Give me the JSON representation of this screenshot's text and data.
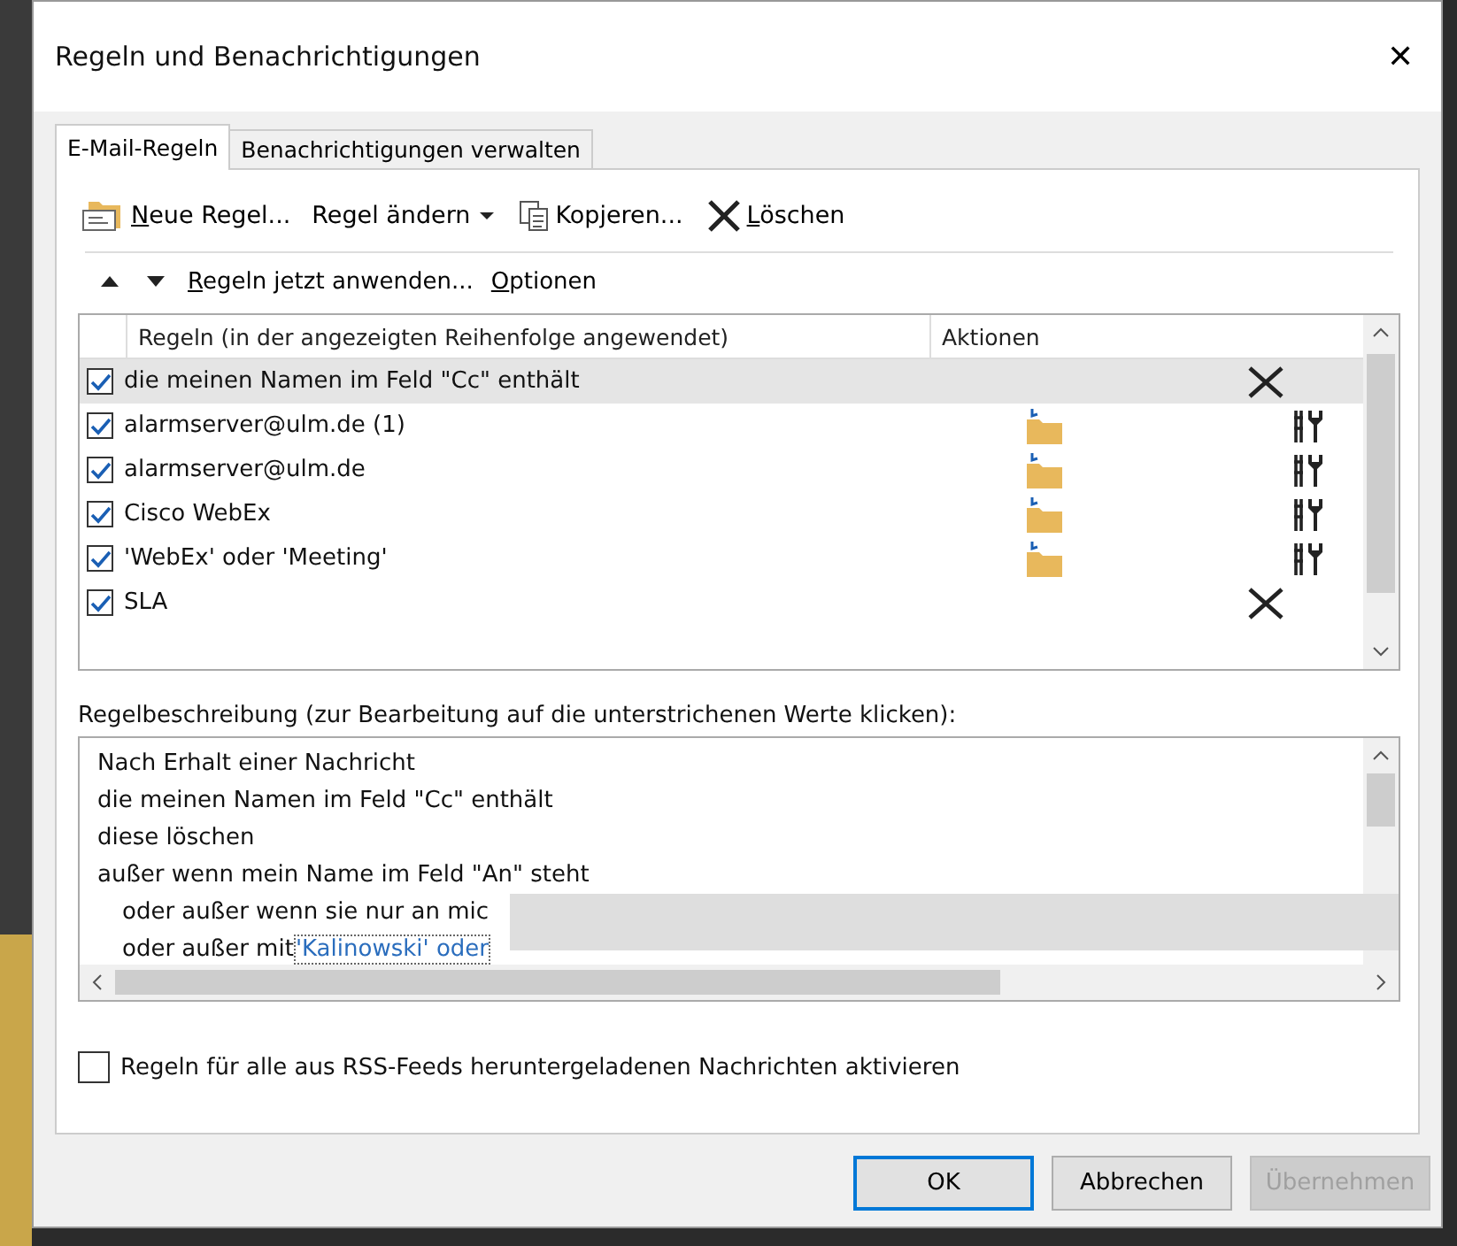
{
  "window": {
    "title": "Regeln und Benachrichtigungen",
    "close": "✕"
  },
  "tabs": [
    {
      "label": "E-Mail-Regeln",
      "selected": true
    },
    {
      "label": "Benachrichtigungen verwalten",
      "selected": false
    }
  ],
  "toolbar": [
    {
      "kind": "new",
      "accel": "N",
      "rest": "eue Regel..."
    },
    {
      "kind": "change",
      "rest": "Regel ändern"
    },
    {
      "kind": "copy",
      "rest": "Kopjeren..."
    },
    {
      "kind": "delete",
      "accel": "L",
      "rest": "öschen"
    }
  ],
  "toolbar2": {
    "apply": "Regeln jetzt anwenden...",
    "options": "Optionen"
  },
  "rules": {
    "columns": [
      "Regeln (in der angezeigten Reihenfolge angewendet)",
      "Aktionen"
    ],
    "rows": [
      {
        "name": "die meinen Namen im Feld \"Cc\" enthält",
        "checked": true,
        "selected": true,
        "kind": "delete"
      },
      {
        "name": "alarmserver@ulm.de (1)",
        "checked": true,
        "selected": false,
        "kind": "move"
      },
      {
        "name": "alarmserver@ulm.de",
        "checked": true,
        "selected": false,
        "kind": "move"
      },
      {
        "name": "Cisco WebEx",
        "checked": true,
        "selected": false,
        "kind": "move"
      },
      {
        "name": "'WebEx' oder 'Meeting'",
        "checked": true,
        "selected": false,
        "kind": "move"
      },
      {
        "name": "SLA",
        "checked": true,
        "selected": false,
        "kind": "delete"
      }
    ]
  },
  "description": {
    "label": "Regelbeschreibung (zur Bearbeitung auf die unterstrichenen Werte klicken):",
    "lines": [
      {
        "text": "Nach Erhalt einer Nachricht"
      },
      {
        "text": "die meinen Namen im Feld \"Cc\" enthält"
      },
      {
        "text": "diese löschen"
      },
      {
        "text": "außer wenn mein Name im Feld \"An\" steht",
        "children": [
          {
            "text": "oder außer wenn sie nur an mic"
          },
          {
            "text": "oder außer mit",
            "link": "'Kalinowski' oder"
          }
        ]
      }
    ]
  },
  "rss": {
    "label": "Regeln für alle aus RSS-Feeds heruntergeladenen Nachrichten aktivieren",
    "checked": false
  },
  "buttons": [
    {
      "label": "OK",
      "kind": "default",
      "disabled": false
    },
    {
      "label": "Abbrechen",
      "kind": "normal",
      "disabled": false
    },
    {
      "label": "Übernehmen",
      "kind": "normal",
      "disabled": true
    }
  ]
}
